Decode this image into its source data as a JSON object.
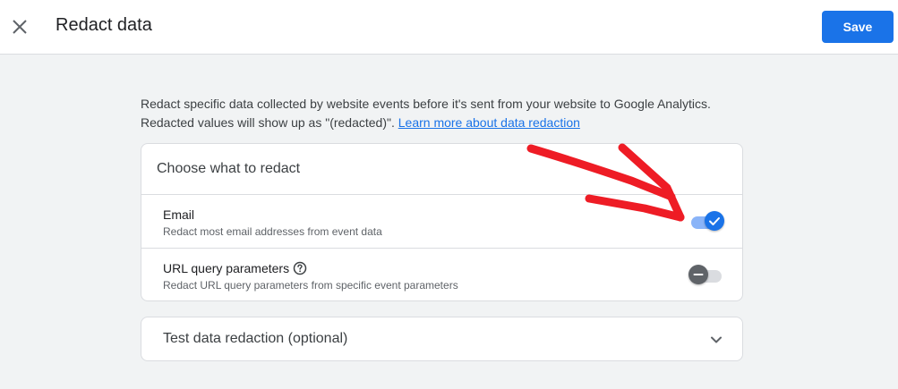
{
  "header": {
    "close_icon": "close-icon",
    "title": "Redact data",
    "save_label": "Save"
  },
  "intro": {
    "line1": "Redact specific data collected by website events before it's sent from your website to Google Analytics.",
    "line2_prefix": "Redacted values will show up as \"(redacted)\". ",
    "learn_more": "Learn more about data redaction"
  },
  "redact_card": {
    "header": "Choose what to redact",
    "items": [
      {
        "title": "Email",
        "description": "Redact most email addresses from event data",
        "enabled": true
      },
      {
        "title": "URL query parameters",
        "description": "Redact URL query parameters from specific event parameters",
        "enabled": false,
        "help_icon": "help-circle-icon"
      }
    ]
  },
  "test_card": {
    "label": "Test data redaction (optional)",
    "expand_icon": "chevron-down-icon"
  },
  "colors": {
    "accent": "#1a73e8",
    "annotation_arrow": "#ee1c25"
  }
}
